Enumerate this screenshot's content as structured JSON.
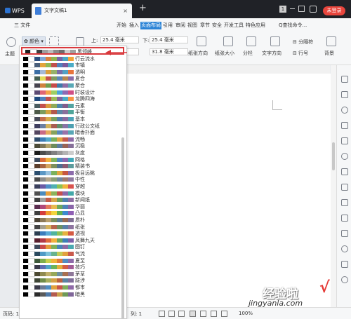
{
  "titlebar": {
    "app_tab": "WPS",
    "doc_tab": "文字文稿1",
    "close": "×",
    "new_tab": "+",
    "badge": "1",
    "login": "未登录"
  },
  "menubar": {
    "file": "三 文件",
    "items": [
      "开始",
      "插入",
      "页面布局",
      "引用",
      "审阅",
      "视图",
      "章节",
      "安全",
      "开发工具",
      "特色应用"
    ],
    "active_index": 2,
    "search": "Q查找命令..."
  },
  "ribbon": {
    "theme_label": "主题",
    "colors_label": "颜色",
    "top_label": "上:",
    "top_value": "25.4 毫米",
    "bottom_label": "下:",
    "bottom_value": "25.4 毫米",
    "left_value": "31.8 毫米",
    "orientation": "纸张方向",
    "size": "纸张大小",
    "columns": "分栏",
    "text_dir": "文字方向",
    "breaks": "分隔符",
    "line_num": "行号",
    "background": "背景"
  },
  "color_schemes": [
    {
      "name": "黑领峰",
      "colors": [
        "#1f1f1f",
        "#ffffff",
        "#404040",
        "#9e9e9e",
        "#bdbdbd",
        "#8a8a8a",
        "#6d6d6d",
        "#cfcfcf",
        "#a0a0a0"
      ]
    },
    {
      "name": "行云流水",
      "colors": [
        "#000000",
        "#ffffff",
        "#2f4f7f",
        "#7fa7d7",
        "#d9813e",
        "#8fb450",
        "#7963a6",
        "#4aa7c4",
        "#f2a33a"
      ]
    },
    {
      "name": "市镇",
      "colors": [
        "#000000",
        "#ffffff",
        "#495e7a",
        "#e3a33b",
        "#8eb857",
        "#c0504d",
        "#4f81bd",
        "#7b5a9c",
        "#4bacc6"
      ]
    },
    {
      "name": "透明",
      "colors": [
        "#000000",
        "#ffffff",
        "#3b6ea5",
        "#a5b9d7",
        "#db9f3c",
        "#95b26a",
        "#7a6ca8",
        "#52a1c4",
        "#e7743c"
      ]
    },
    {
      "name": "夏合",
      "colors": [
        "#000000",
        "#ffffff",
        "#455f51",
        "#e3dc5a",
        "#c6514a",
        "#7f9c61",
        "#5b86b9",
        "#b9874f",
        "#8a6ca6"
      ]
    },
    {
      "name": "聚合",
      "colors": [
        "#000000",
        "#ffffff",
        "#46434e",
        "#d0813d",
        "#6e9d4f",
        "#c64a4a",
        "#3e7aa9",
        "#8e6da6",
        "#58a8b5"
      ]
    },
    {
      "name": "时装设计",
      "colors": [
        "#000000",
        "#ffffff",
        "#5c4a72",
        "#e06574",
        "#f3a447",
        "#9ccf64",
        "#4ba5d8",
        "#8d6bb4",
        "#d04f86"
      ]
    },
    {
      "name": "龙腾四海",
      "colors": [
        "#000000",
        "#ffffff",
        "#1f497d",
        "#4f81bd",
        "#c0504d",
        "#9bbb59",
        "#8064a2",
        "#4bacc6",
        "#f79646"
      ]
    },
    {
      "name": "元素",
      "colors": [
        "#000000",
        "#ffffff",
        "#495b5f",
        "#c3504e",
        "#d99b3e",
        "#8fa959",
        "#4e86ac",
        "#825d8c",
        "#52a3a0"
      ]
    },
    {
      "name": "平衡",
      "colors": [
        "#000000",
        "#ffffff",
        "#4d5a48",
        "#7c9b5d",
        "#d3a33f",
        "#b2574c",
        "#5c86a6",
        "#8a6f9c",
        "#50a59a"
      ]
    },
    {
      "name": "基本",
      "colors": [
        "#000000",
        "#ffffff",
        "#494b58",
        "#c56d4d",
        "#d7a94b",
        "#79a05d",
        "#4f7eae",
        "#8a6aa0",
        "#4ea3b8"
      ]
    },
    {
      "name": "行政公文纸",
      "colors": [
        "#000000",
        "#ffffff",
        "#3f3f5f",
        "#6b7fa3",
        "#d3b35d",
        "#a85c52",
        "#5f8e6b",
        "#8a73a6",
        "#4c9fb0"
      ]
    },
    {
      "name": "暗香扑面",
      "colors": [
        "#000000",
        "#ffffff",
        "#53455e",
        "#c96a86",
        "#e5ab5d",
        "#86a35d",
        "#5a88ba",
        "#9a72a9",
        "#58a6b6"
      ]
    },
    {
      "name": "流畅",
      "colors": [
        "#000000",
        "#ffffff",
        "#2d4b6a",
        "#3e7db6",
        "#52a8c9",
        "#7ab15b",
        "#e1a33f",
        "#c65a4c",
        "#8d6aa7"
      ]
    },
    {
      "name": "沉稳",
      "colors": [
        "#000000",
        "#ffffff",
        "#4b4b38",
        "#7f7757",
        "#b5a66c",
        "#6d8c5a",
        "#5c7d9f",
        "#9a6455",
        "#867099"
      ]
    },
    {
      "name": "灰度",
      "colors": [
        "#000000",
        "#ffffff",
        "#1a1a1a",
        "#4d4d4d",
        "#666666",
        "#808080",
        "#999999",
        "#b3b3b3",
        "#cccccc"
      ]
    },
    {
      "name": "网格",
      "colors": [
        "#000000",
        "#ffffff",
        "#3e4b5e",
        "#d96a3c",
        "#f0b13f",
        "#7fb35d",
        "#4d86c6",
        "#8c69af",
        "#3fa8b8"
      ]
    },
    {
      "name": "精装书",
      "colors": [
        "#000000",
        "#ffffff",
        "#5c3f2d",
        "#a76443",
        "#d4a55e",
        "#7d8f5a",
        "#4d6f92",
        "#8c5b74",
        "#5c9b9c"
      ]
    },
    {
      "name": "极目远眺",
      "colors": [
        "#000000",
        "#ffffff",
        "#2a4d6e",
        "#5a96c4",
        "#98c1de",
        "#7bb15a",
        "#e0a63f",
        "#c8573f",
        "#8c6bab"
      ]
    },
    {
      "name": "中性",
      "colors": [
        "#000000",
        "#ffffff",
        "#4a4a4a",
        "#8c8c8c",
        "#b3a58a",
        "#8a9e76",
        "#6f87a1",
        "#a07a6e",
        "#8e7aa0"
      ]
    },
    {
      "name": "穿越",
      "colors": [
        "#000000",
        "#ffffff",
        "#3a3f5c",
        "#6a5aa5",
        "#4f8fc7",
        "#4fb0b0",
        "#8cc152",
        "#f0b43c",
        "#d9534f"
      ]
    },
    {
      "name": "模块",
      "colors": [
        "#000000",
        "#ffffff",
        "#4f4f4f",
        "#4b8bbe",
        "#e8a03b",
        "#8cb25b",
        "#c7504b",
        "#8a69a8",
        "#43a8a9"
      ]
    },
    {
      "name": "新闻纸",
      "colors": [
        "#000000",
        "#ffffff",
        "#3f3f3f",
        "#a0a0a0",
        "#c45b4a",
        "#d6a54c",
        "#6e9f5c",
        "#4f82b0",
        "#8e6ea4"
      ]
    },
    {
      "name": "华丽",
      "colors": [
        "#000000",
        "#ffffff",
        "#5b2d4f",
        "#b0487a",
        "#e37a5b",
        "#e8b94f",
        "#6fa85c",
        "#4e86b9",
        "#8a66a9"
      ]
    },
    {
      "name": "凸显",
      "colors": [
        "#000000",
        "#ffffff",
        "#3e3e3e",
        "#d43c3c",
        "#f29c2b",
        "#f2d43c",
        "#65b04e",
        "#3b8ad0",
        "#8f5fb4"
      ]
    },
    {
      "name": "质朴",
      "colors": [
        "#000000",
        "#ffffff",
        "#4c4436",
        "#8d7a58",
        "#b8a06e",
        "#7a8f5c",
        "#5c7e96",
        "#9a6a52",
        "#7e6d93"
      ]
    },
    {
      "name": "纸张",
      "colors": [
        "#000000",
        "#ffffff",
        "#444444",
        "#a5a08f",
        "#d5b35d",
        "#b5654d",
        "#6d9061",
        "#5a80a8",
        "#8d749f"
      ]
    },
    {
      "name": "透视",
      "colors": [
        "#000000",
        "#ffffff",
        "#2c3e50",
        "#3b7cbd",
        "#5aa9d6",
        "#4fb49c",
        "#8dc154",
        "#e6b13f",
        "#d45a43"
      ]
    },
    {
      "name": "凤舞九天",
      "colors": [
        "#000000",
        "#ffffff",
        "#5a1f2d",
        "#b23a48",
        "#e06b3b",
        "#f2b13f",
        "#6fa658",
        "#3d7fb8",
        "#7d5ea8"
      ]
    },
    {
      "name": "图钉",
      "colors": [
        "#000000",
        "#ffffff",
        "#3f4a5c",
        "#c94b4b",
        "#e59c3c",
        "#7faf5a",
        "#4a86b8",
        "#8e6aa6",
        "#4aa9b0"
      ]
    },
    {
      "name": "气流",
      "colors": [
        "#000000",
        "#ffffff",
        "#29495e",
        "#4f9ac5",
        "#7dc2d9",
        "#67b38d",
        "#c2cc57",
        "#e2a03e",
        "#c95a4c"
      ]
    },
    {
      "name": "夏至",
      "colors": [
        "#000000",
        "#ffffff",
        "#3e5a3a",
        "#7cae4f",
        "#c8d04d",
        "#f0b33b",
        "#e07a3b",
        "#4f8cc4",
        "#8e6aaa"
      ]
    },
    {
      "name": "技巧",
      "colors": [
        "#000000",
        "#ffffff",
        "#3a3a4a",
        "#5d6db3",
        "#4fa6c8",
        "#6cb35a",
        "#e2ae3c",
        "#d45c45",
        "#a25c96"
      ]
    },
    {
      "name": "茅草",
      "colors": [
        "#000000",
        "#ffffff",
        "#4d4a33",
        "#8f8a4f",
        "#c0b06a",
        "#96a85a",
        "#6d8fa0",
        "#a86f50",
        "#8e7899"
      ]
    },
    {
      "name": "跋涉",
      "colors": [
        "#000000",
        "#ffffff",
        "#3e4635",
        "#6e8c4a",
        "#a8ae5c",
        "#d3a048",
        "#b9613f",
        "#5983a3",
        "#7f6d99"
      ]
    },
    {
      "name": "都市",
      "colors": [
        "#000000",
        "#ffffff",
        "#3b3b4a",
        "#6b7b95",
        "#4f8ec3",
        "#e1a13e",
        "#c7564a",
        "#7eaf5c",
        "#8e6aa7"
      ]
    },
    {
      "name": "暗黑",
      "colors": [
        "#000000",
        "#ffffff",
        "#2b2b2b",
        "#5a5a5a",
        "#4f79a8",
        "#b45c4f",
        "#c9a24b",
        "#6f9a58",
        "#7f6699"
      ]
    }
  ],
  "statusbar": {
    "page": "页码: 1",
    "col": "列: 1",
    "zoom": "100%"
  },
  "watermark": {
    "text": "经验啦",
    "url": "jingyanla.com"
  }
}
